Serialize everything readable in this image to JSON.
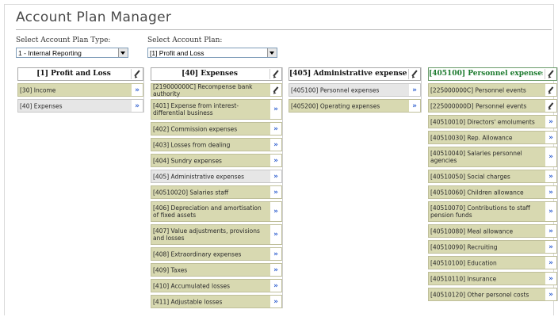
{
  "app": {
    "title": "Account Plan Manager"
  },
  "selectors": {
    "plan_type_label": "Select Account Plan Type:",
    "plan_type_value": "1 - Internal Reporting",
    "plan_label": "Select Account Plan:",
    "plan_value": "[1] Profit and Loss"
  },
  "columns": [
    {
      "header": "[1] Profit and Loss",
      "rows": [
        {
          "label": "[30] Income",
          "action": "drill",
          "selected": false
        },
        {
          "label": "[40] Expenses",
          "action": "drill",
          "selected": true
        }
      ]
    },
    {
      "header": "[40] Expenses",
      "rows": [
        {
          "label": "[219000000C] Recompense bank authority",
          "action": "edit",
          "selected": false
        },
        {
          "label": "[401] Expense from interest-differential business",
          "action": "drill",
          "selected": false
        },
        {
          "label": "[402] Commission expenses",
          "action": "drill",
          "selected": false
        },
        {
          "label": "[403] Losses from dealing",
          "action": "drill",
          "selected": false
        },
        {
          "label": "[404] Sundry expenses",
          "action": "drill",
          "selected": false
        },
        {
          "label": "[405] Administrative expenses",
          "action": "drill",
          "selected": true
        },
        {
          "label": "[40510020] Salaries staff",
          "action": "drill",
          "selected": false
        },
        {
          "label": "[406] Depreciation and amortisation of fixed assets",
          "action": "drill",
          "selected": false
        },
        {
          "label": "[407] Value adjustments, provisions and losses",
          "action": "drill",
          "selected": false
        },
        {
          "label": "[408] Extraordinary expenses",
          "action": "drill",
          "selected": false
        },
        {
          "label": "[409] Taxes",
          "action": "drill",
          "selected": false
        },
        {
          "label": "[410] Accumulated losses",
          "action": "drill",
          "selected": false
        },
        {
          "label": "[411] Adjustable losses",
          "action": "drill",
          "selected": false
        }
      ]
    },
    {
      "header": "[405] Administrative expenses",
      "rows": [
        {
          "label": "[405100] Personnel expenses",
          "action": "drill",
          "selected": true
        },
        {
          "label": "[405200] Operating expenses",
          "action": "drill",
          "selected": false
        }
      ]
    },
    {
      "header": "[405100] Personnel expenses",
      "rows": [
        {
          "label": "[225000000C] Personnel events",
          "action": "edit",
          "selected": false
        },
        {
          "label": "[225000000D] Personnel events",
          "action": "edit",
          "selected": false
        },
        {
          "label": "[40510010] Directors' emoluments",
          "action": "drill",
          "selected": false
        },
        {
          "label": "[40510030] Rep. Allowance",
          "action": "drill",
          "selected": false
        },
        {
          "label": "[40510040] Salaries personnel agencies",
          "action": "drill",
          "selected": false
        },
        {
          "label": "[40510050] Social charges",
          "action": "drill",
          "selected": false
        },
        {
          "label": "[40510060] Children allowance",
          "action": "drill",
          "selected": false
        },
        {
          "label": "[40510070] Contributions to staff pension funds",
          "action": "drill",
          "selected": false
        },
        {
          "label": "[40510080] Meal allowance",
          "action": "drill",
          "selected": false
        },
        {
          "label": "[40510090] Recruiting",
          "action": "drill",
          "selected": false
        },
        {
          "label": "[40510100] Education",
          "action": "drill",
          "selected": false
        },
        {
          "label": "[40510110] Insurance",
          "action": "drill",
          "selected": false
        },
        {
          "label": "[40510120] Other personel costs",
          "action": "drill",
          "selected": false
        }
      ]
    }
  ],
  "icons": {
    "drill_glyph": "»",
    "header_edit": "pencil-icon",
    "row_drill": "double-chevron-right-icon",
    "row_edit": "pencil-icon"
  },
  "colors": {
    "row_bg": "#d8d9b1",
    "row_selected_bg": "#e6e6e6",
    "drill_icon": "#2f5fcf",
    "last_header_text": "#1c7a2e",
    "title_text": "#4a4a4a"
  }
}
